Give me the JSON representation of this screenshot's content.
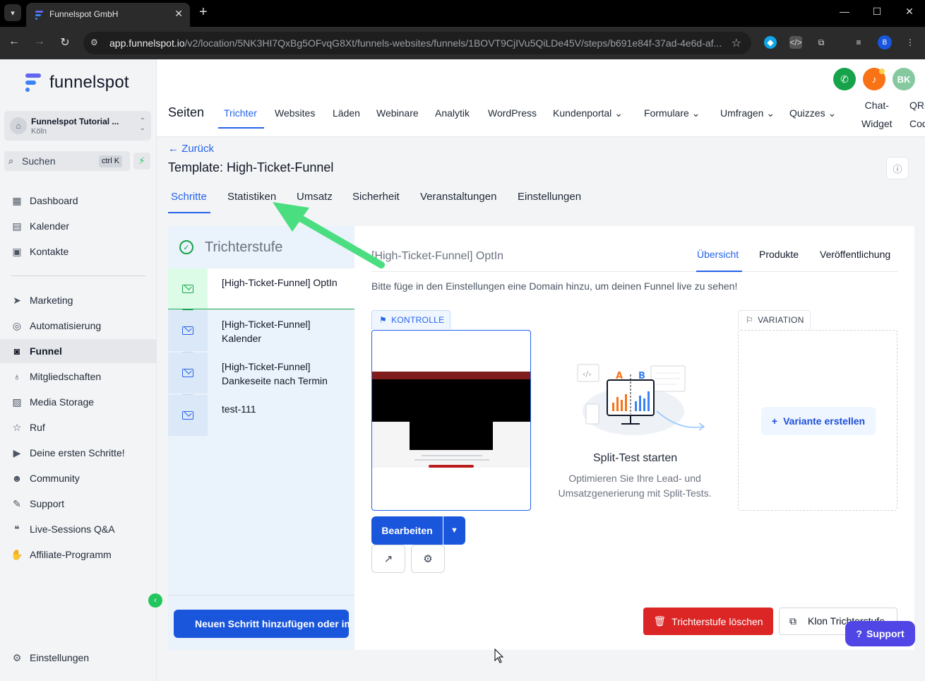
{
  "browser": {
    "tab_title": "Funnelspot GmbH",
    "url_host": "app.funnelspot.io",
    "url_path": "/v2/location/5NK3HI7QxBg5OFvqG8Xt/funnels-websites/funnels/1BOVT9CjIVu5QiLDe45V/steps/b691e84f-37ad-4e6d-af...",
    "profile_initial": "B"
  },
  "brand": {
    "name": "funnelspot"
  },
  "location": {
    "name": "Funnelspot Tutorial ...",
    "city": "Köln"
  },
  "search": {
    "placeholder": "Suchen",
    "shortcut": "ctrl K"
  },
  "sidebar": {
    "items": [
      {
        "label": "Dashboard",
        "icon": "dashboard-icon"
      },
      {
        "label": "Kalender",
        "icon": "calendar-icon"
      },
      {
        "label": "Kontakte",
        "icon": "contacts-icon"
      },
      {
        "label": "Marketing",
        "icon": "send-icon"
      },
      {
        "label": "Automatisierung",
        "icon": "automation-icon"
      },
      {
        "label": "Funnel",
        "icon": "funnel-icon"
      },
      {
        "label": "Mitgliedschaften",
        "icon": "membership-icon"
      },
      {
        "label": "Media Storage",
        "icon": "image-icon"
      },
      {
        "label": "Ruf",
        "icon": "star-icon"
      },
      {
        "label": "Deine ersten Schritte!",
        "icon": "play-icon"
      },
      {
        "label": "Community",
        "icon": "community-icon"
      },
      {
        "label": "Support",
        "icon": "wrench-icon"
      },
      {
        "label": "Live-Sessions Q&A",
        "icon": "chat-icon"
      },
      {
        "label": "Affiliate-Programm",
        "icon": "affiliate-icon"
      }
    ],
    "settings_label": "Einstellungen"
  },
  "header": {
    "avatar_initials": "BK",
    "section_title": "Seiten",
    "nav": [
      {
        "label": "Trichter"
      },
      {
        "label": "Websites"
      },
      {
        "label": "Läden"
      },
      {
        "label": "Webinare"
      },
      {
        "label": "Analytik"
      },
      {
        "label": "WordPress"
      },
      {
        "label": "Kundenportal"
      },
      {
        "label": "Formulare"
      },
      {
        "label": "Umfragen"
      },
      {
        "label": "Quizzes"
      }
    ],
    "nav_chat_line1": "Chat-",
    "nav_chat_line2": "Widget",
    "nav_qr_line1": "QR-",
    "nav_qr_line2": "Cod"
  },
  "page": {
    "back_label": "Zurück",
    "title": "Template: High-Ticket-Funnel",
    "tabs": [
      {
        "label": "Schritte"
      },
      {
        "label": "Statistiken"
      },
      {
        "label": "Umsatz"
      },
      {
        "label": "Sicherheit"
      },
      {
        "label": "Veranstaltungen"
      },
      {
        "label": "Einstellungen"
      }
    ]
  },
  "steps": {
    "header": "Trichterstufe",
    "items": [
      {
        "line1": "[High-Ticket-Funnel] OptIn",
        "line2": ""
      },
      {
        "line1": "[High-Ticket-Funnel]",
        "line2": "Kalender"
      },
      {
        "line1": "[High-Ticket-Funnel]",
        "line2": "Dankeseite nach Termin"
      },
      {
        "line1": "test-111",
        "line2": ""
      }
    ],
    "add_button": "Neuen Schritt hinzufügen oder importieren"
  },
  "detail": {
    "title": "[High-Ticket-Funnel] OptIn",
    "tabs": [
      {
        "label": "Übersicht"
      },
      {
        "label": "Produkte"
      },
      {
        "label": "Veröffentlichung"
      }
    ],
    "domain_message": "Bitte füge in den Einstellungen eine Domain hinzu, um deinen Funnel live zu sehen!",
    "control_badge": "KONTROLLE",
    "variation_badge": "VARIATION",
    "split_title": "Split-Test starten",
    "split_desc": "Optimieren Sie Ihre Lead- und Umsatzgenerierung mit Split-Tests.",
    "add_variant": "Variante erstellen",
    "edit_button": "Bearbeiten",
    "delete_button": "Trichterstufe löschen",
    "clone_button": "Klon Trichterstufe"
  },
  "support_label": "Support"
}
